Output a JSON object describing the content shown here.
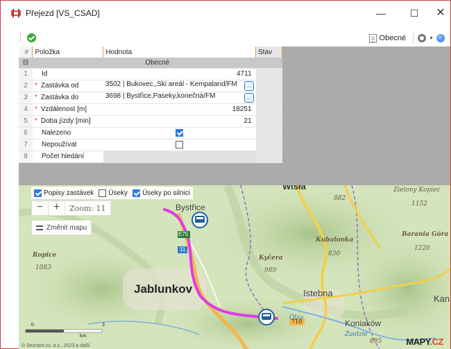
{
  "window": {
    "title": "Přejezd [VS_CSAD]",
    "minimize_glyph": "—",
    "maximize_glyph": "☐",
    "close_glyph": "✕"
  },
  "toolbar": {
    "general_label": "Obecné"
  },
  "grid": {
    "headers": {
      "num": "#",
      "item": "Položka",
      "value": "Hodnota",
      "status": "Stav"
    },
    "group_toggle": "⊟",
    "group_label": "Obecné",
    "rows": [
      {
        "num": "1",
        "label": "Id",
        "value": "4711"
      },
      {
        "num": "2",
        "label": "Zastávka od",
        "value": "3502 | Bukovec,,Ski areál - Kempaland/FM"
      },
      {
        "num": "3",
        "label": "Zastávka do",
        "value": "3698 | Bystřice,Paseky,konečná/FM"
      },
      {
        "num": "4",
        "label": "Vzdálenost [m]",
        "value": "18251"
      },
      {
        "num": "5",
        "label": "Doba jízdy [min]",
        "value": "21"
      },
      {
        "num": "6",
        "label": "Nalezeno",
        "value": "checked"
      },
      {
        "num": "7",
        "label": "Nepoužívat",
        "value": "unchecked"
      },
      {
        "num": "8",
        "label": "Počet hledání",
        "value": ""
      }
    ],
    "required_mark": "*",
    "picker_glyph": "..."
  },
  "map": {
    "layers": [
      {
        "label": "Popisy zastávek",
        "checked": true
      },
      {
        "label": "Úseky",
        "checked": false
      },
      {
        "label": "Úseky po silnici",
        "checked": true
      }
    ],
    "zoom_minus": "−",
    "zoom_plus": "+",
    "zoom_label": "Zoom: 11",
    "change_map_label": "Změnit mapu",
    "labels": {
      "wisla": "Wisła",
      "zielony_kopiec": "Zielony Kopiec",
      "zielony_kopiec_height": "1152",
      "height_882": "882",
      "bystrice": "Bystřice",
      "barania_gora": "Barania Góra",
      "barania_gora_height": "1220",
      "kubalonka": "Kubalonka",
      "kubalonka_height": "830",
      "ropice": "Ropice",
      "ropice_height": "1083",
      "kycera": "Kyčera",
      "kycera_height": "989",
      "jablunkov": "Jablunkov",
      "istebna": "Istebna",
      "kan": "Kan",
      "olza": "Olza",
      "koniakow": "Koniaków",
      "zaolzie": "Zaolzie",
      "height_895": "895",
      "road_e75": "E75",
      "road_11": "11",
      "road_710": "710",
      "scale_0": "0",
      "scale_3": "3",
      "scale_unit": "km",
      "copyright": "© Seznam.cz, a.s., 2023 a další",
      "logo_main": "MAPY",
      "logo_suffix": ".CZ"
    },
    "route_color": "#e13be6"
  }
}
